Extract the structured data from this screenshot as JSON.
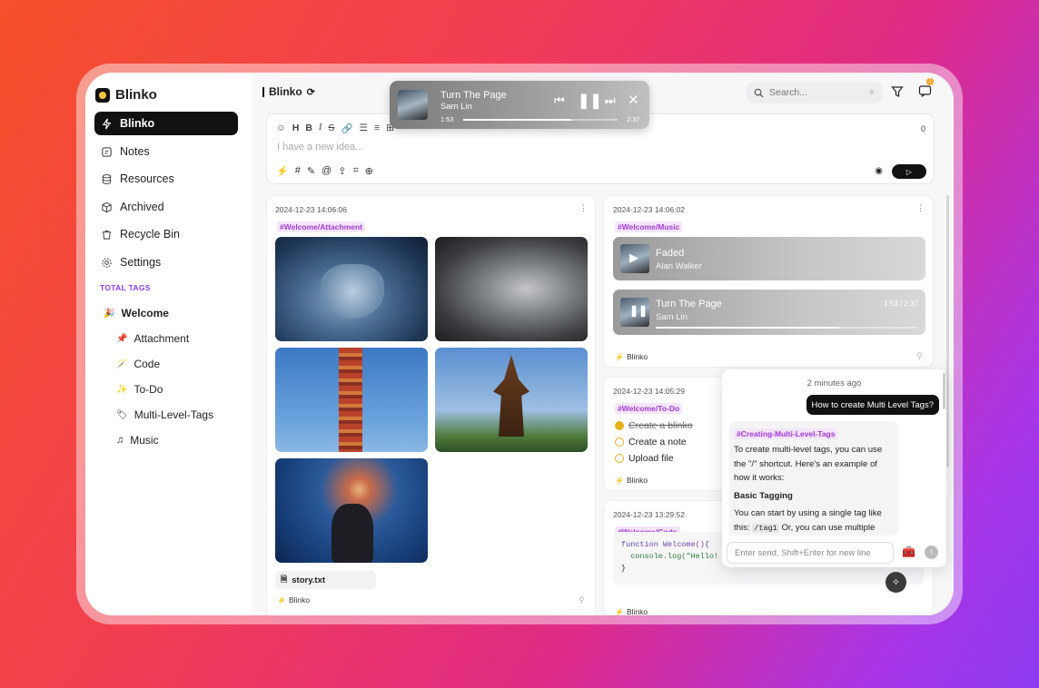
{
  "sidebar": {
    "brand": "Blinko",
    "nav": [
      {
        "label": "Blinko",
        "icon": "bolt-icon",
        "active": true
      },
      {
        "label": "Notes",
        "icon": "notes-icon"
      },
      {
        "label": "Resources",
        "icon": "database-icon"
      },
      {
        "label": "Archived",
        "icon": "box-icon"
      },
      {
        "label": "Recycle Bin",
        "icon": "trash-icon"
      },
      {
        "label": "Settings",
        "icon": "gear-icon"
      }
    ],
    "tags_title": "TOTAL TAGS",
    "tags": [
      {
        "label": "Welcome",
        "emoji": "🎉"
      },
      {
        "label": "Attachment",
        "emoji": "📌"
      },
      {
        "label": "Code",
        "emoji": "🪄"
      },
      {
        "label": "To-Do",
        "emoji": "✨"
      },
      {
        "label": "Multi-Level-Tags",
        "emoji": "🏷"
      },
      {
        "label": "Music",
        "emoji": "♫"
      }
    ]
  },
  "topbar": {
    "title": "Blinko",
    "search_placeholder": "Search...",
    "notify_count": "1"
  },
  "editor": {
    "placeholder": "I have a new idea...",
    "count": "0"
  },
  "player": {
    "title": "Turn The Page",
    "artist": "Sam Lin",
    "elapsed": "1:53",
    "total": "2:37",
    "progress": 0.7
  },
  "cards": {
    "attachment": {
      "date": "2024-12-23 14:06:06",
      "tag": "#Welcome/Attachment",
      "file": "story.txt",
      "footer": "Blinko"
    },
    "music": {
      "date": "2024-12-23 14:06:02",
      "tag": "#Welcome/Music",
      "footer": "Blinko",
      "tracks": [
        {
          "title": "Faded",
          "artist": "Alan Walker"
        },
        {
          "title": "Turn The Page",
          "artist": "Sam Lin",
          "time": "1:53 / 2:37",
          "progress": 0.7
        }
      ]
    },
    "todo": {
      "date": "2024-12-23 14:05:29",
      "tag": "#Welcome/To-Do",
      "footer": "Blinko",
      "items": [
        {
          "label": "Create a blinko",
          "done": true
        },
        {
          "label": "Create a note",
          "done": false
        },
        {
          "label": "Upload file",
          "done": false
        }
      ]
    },
    "code": {
      "date": "2024-12-23 13:29:52",
      "tag": "#Welcome/Code",
      "lines": [
        "function Welcome(){",
        "  console.log(\"Hello! Blinko\");",
        "}"
      ],
      "footer": "Blinko"
    }
  },
  "chat": {
    "time": "2 minutes ago",
    "question": "How to create Multi Level Tags?",
    "answer_tag": "#Creating-Multi-Level-Tags",
    "answer_p1": "To create multi-level tags, you can use the \"/\" shortcut. Here's an example of how it works:",
    "answer_heading": "Basic Tagging",
    "answer_p2_a": "You can start by using a single tag like this: ",
    "answer_p2_code": "/tag1",
    "answer_p2_b": " Or, you can use multiple",
    "input_placeholder": "Enter send, Shift+Enter for new line"
  },
  "colors": {
    "accent": "#111111",
    "tag": "#a23ad6",
    "todo": "#e8b118",
    "tags_title": "#8b3cf6"
  }
}
